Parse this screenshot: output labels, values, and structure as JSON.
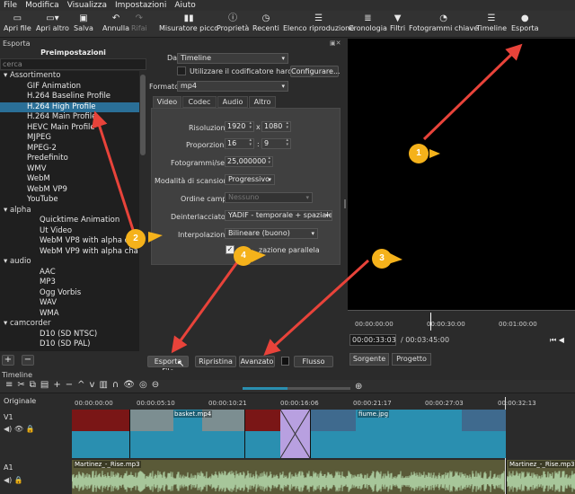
{
  "menu": [
    "File",
    "Modifica",
    "Visualizza",
    "Impostazioni",
    "Aiuto"
  ],
  "toolbar": [
    {
      "label": "Apri file",
      "icon": "folder-icon",
      "glyph": "▭"
    },
    {
      "label": "Apri altro",
      "icon": "open-other-icon",
      "glyph": "▭▾"
    },
    {
      "label": "Salva",
      "icon": "save-icon",
      "glyph": "💾"
    },
    {
      "label": "Annulla",
      "icon": "undo-icon",
      "glyph": "↶"
    },
    {
      "label": "Rifai",
      "icon": "redo-icon",
      "glyph": "↷"
    },
    {
      "label": "Misuratore picco",
      "icon": "meter-icon",
      "glyph": "▮▮"
    },
    {
      "label": "Proprietà",
      "icon": "info-icon",
      "glyph": "ⓘ"
    },
    {
      "label": "Recenti",
      "icon": "recent-icon",
      "glyph": "◷"
    },
    {
      "label": "Elenco riproduzione",
      "icon": "playlist-icon",
      "glyph": "☰"
    },
    {
      "label": "Cronologia",
      "icon": "history-icon",
      "glyph": "≣"
    },
    {
      "label": "Filtri",
      "icon": "filter-icon",
      "glyph": "▼"
    },
    {
      "label": "Fotogrammi chiave",
      "icon": "keyframe-icon",
      "glyph": "◔"
    },
    {
      "label": "Timeline",
      "icon": "timeline-icon",
      "glyph": "☰"
    },
    {
      "label": "Esporta",
      "icon": "export-icon",
      "glyph": "●"
    }
  ],
  "export_panel": {
    "title": "Esporta",
    "presets_header": "Preimpostazioni",
    "search_placeholder": "cerca",
    "presets": [
      {
        "t": "Assortimento",
        "lvl": 0,
        "grp": true
      },
      {
        "t": "GIF Animation",
        "lvl": 1
      },
      {
        "t": "H.264 Baseline Profile",
        "lvl": 1
      },
      {
        "t": "H.264 High Profile",
        "lvl": 1,
        "sel": true
      },
      {
        "t": "H.264 Main Profile",
        "lvl": 1
      },
      {
        "t": "HEVC Main Profile",
        "lvl": 1
      },
      {
        "t": "MJPEG",
        "lvl": 1
      },
      {
        "t": "MPEG-2",
        "lvl": 1
      },
      {
        "t": "Predefinito",
        "lvl": 1
      },
      {
        "t": "WMV",
        "lvl": 1
      },
      {
        "t": "WebM",
        "lvl": 1
      },
      {
        "t": "WebM VP9",
        "lvl": 1
      },
      {
        "t": "YouTube",
        "lvl": 1
      },
      {
        "t": "alpha",
        "lvl": 0,
        "grp": true
      },
      {
        "t": "Quicktime Animation",
        "lvl": 2
      },
      {
        "t": "Ut Video",
        "lvl": 2
      },
      {
        "t": "WebM VP8 with alpha ch",
        "lvl": 2
      },
      {
        "t": "WebM VP9 with alpha cha",
        "lvl": 2
      },
      {
        "t": "audio",
        "lvl": 0,
        "grp": true
      },
      {
        "t": "AAC",
        "lvl": 2
      },
      {
        "t": "MP3",
        "lvl": 2
      },
      {
        "t": "Ogg Vorbis",
        "lvl": 2
      },
      {
        "t": "WAV",
        "lvl": 2
      },
      {
        "t": "WMA",
        "lvl": 2
      },
      {
        "t": "camcorder",
        "lvl": 0,
        "grp": true
      },
      {
        "t": "D10 (SD NTSC)",
        "lvl": 2
      },
      {
        "t": "D10 (SD PAL)",
        "lvl": 2
      }
    ],
    "add_label": "+",
    "remove_label": "−",
    "da_label": "Da",
    "da_value": "Timeline",
    "hw_label": "Utilizzare il codificatore hardware",
    "configure_label": "Configurare...",
    "format_label": "Formato",
    "format_value": "mp4",
    "tabs": [
      "Video",
      "Codec",
      "Audio",
      "Altro"
    ],
    "video": {
      "res_label": "Risoluzione",
      "res_w": "1920",
      "res_x": "x",
      "res_h": "1080",
      "aspect_label": "Proporzioni",
      "aspect_w": "16",
      "aspect_colon": ":",
      "aspect_h": "9",
      "fps_label": "Fotogrammi/sec",
      "fps_value": "25,000000",
      "scan_label": "Modalità di scansione",
      "scan_value": "Progressivo",
      "field_label": "Ordine campi",
      "field_value": "Nessuno",
      "deint_label": "Deinterlacciatore",
      "deint_value": "YADIF - temporale + spaziale (m",
      "interp_label": "Interpolazione",
      "interp_value": "Bilineare (buono)",
      "parallel_label": "zazione parallela"
    },
    "buttons": {
      "export": "Esporta File",
      "reset": "Ripristina",
      "advanced": "Avanzato",
      "stream": "Flusso"
    }
  },
  "player": {
    "ruler": [
      "00:00:00:00",
      "00:00:30:00",
      "00:01:00:00"
    ],
    "position": "00:00:33:03",
    "duration": "/ 00:03:45:00",
    "tabs": [
      "Sorgente",
      "Progetto"
    ]
  },
  "timeline": {
    "title": "Timeline",
    "header": "Originale",
    "ticks": [
      "00:00:00:00",
      "00:00:05:10",
      "00:00:10:21",
      "00:00:16:06",
      "00:00:21:17",
      "00:00:27:03",
      "00:00:32:13"
    ],
    "v1": "V1",
    "a1": "A1",
    "clips": {
      "basket": "basket.mp4",
      "fiume": "fiume.jpg",
      "audio1": "Martinez_-_Rise.mp3",
      "audio2": "Martinez_-_Rise.mp3"
    }
  },
  "callouts": [
    "1",
    "2",
    "3",
    "4"
  ],
  "colors": {
    "callout": "#f5b21b",
    "arrow": "#e8433a",
    "selection": "#2a6f97",
    "video_clip": "#2a8fb0",
    "audio_clip": "#5a5a38"
  }
}
